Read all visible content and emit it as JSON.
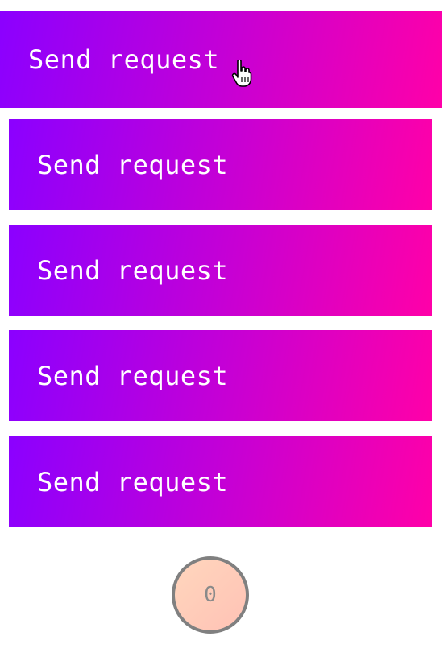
{
  "buttons": [
    {
      "label": "Send request",
      "state": "hover"
    },
    {
      "label": "Send request",
      "state": "normal"
    },
    {
      "label": "Send request",
      "state": "normal"
    },
    {
      "label": "Send request",
      "state": "normal"
    },
    {
      "label": "Send request",
      "state": "normal"
    }
  ],
  "counter": {
    "value": "0"
  },
  "colors": {
    "gradient_start": "#8b00ff",
    "gradient_end": "#ff00a8",
    "counter_border": "#808080",
    "counter_fill": "#ffd6bd"
  },
  "cursor": {
    "icon": "hand-pointer-icon"
  }
}
